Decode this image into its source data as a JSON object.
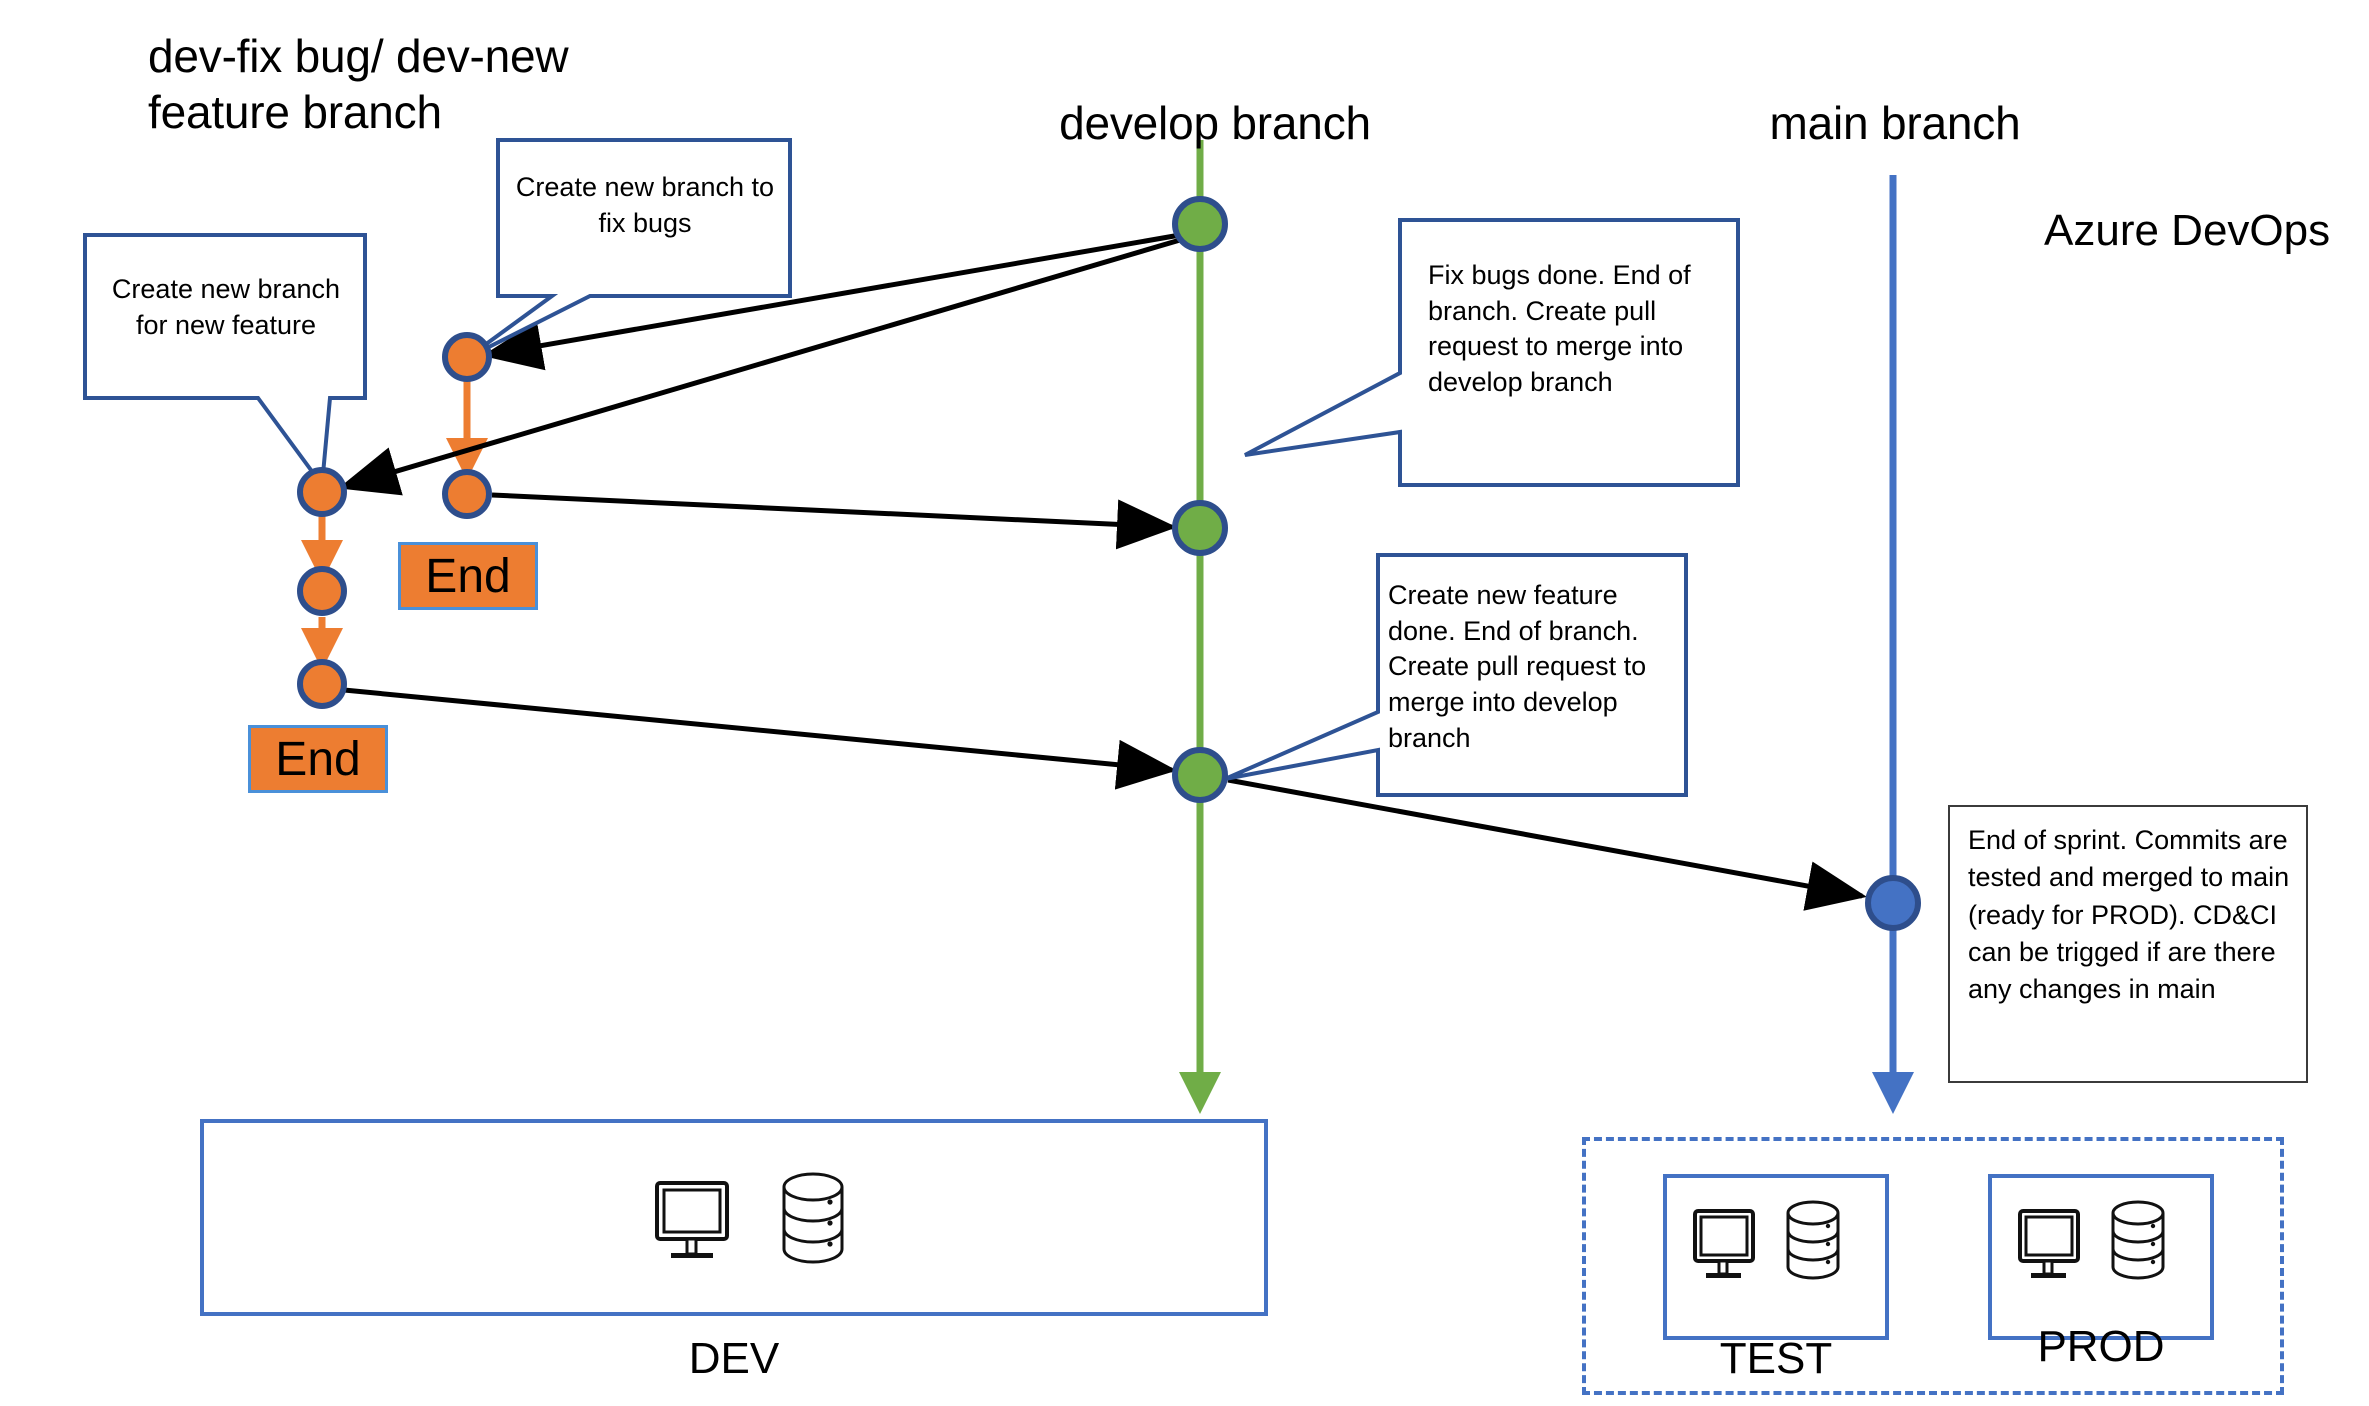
{
  "diagram": {
    "title_note": "Azure DevOps git branching strategy",
    "colors": {
      "orange_fill": "#ED7D31",
      "green_fill": "#70AD47",
      "blue_fill": "#4472C4",
      "node_stroke": "#2E4E8C",
      "callout_stroke": "#2E5395",
      "arrow_black": "#000000",
      "endbox_border": "#4A90D9"
    }
  },
  "branch_labels": [
    {
      "name": "feature-branch-label",
      "text": "dev-fix bug/ dev-new\nfeature branch"
    },
    {
      "name": "develop-branch-label",
      "text": "develop branch"
    },
    {
      "name": "main-branch-label",
      "text": "main branch"
    }
  ],
  "azure_label": "Azure DevOps",
  "callouts": [
    {
      "id": "create-new-branch-for-new-feature",
      "text": "Create new branch\nfor new feature"
    },
    {
      "id": "create-new-branch-to-fix-bugs",
      "text": "Create new branch to\nfix bugs"
    },
    {
      "id": "fix-bugs-done",
      "text": "Fix bugs done. End\nof branch. Create\npull request to\nmerge into develop\nbranch"
    },
    {
      "id": "create-new-feature-done",
      "text": "Create new feature\ndone. End of branch.\nCreate pull request\nto merge into\ndevelop branch"
    }
  ],
  "notes": [
    {
      "id": "end-of-sprint-note",
      "text": "End of sprint. Commits are\ntested and merged to main\n(ready for PROD). CD&CI\ncan be trigged if are there\nany changes in main"
    }
  ],
  "end_markers": [
    {
      "id": "end-marker-fixbug",
      "label": "End"
    },
    {
      "id": "end-marker-feature",
      "label": "End"
    }
  ],
  "environments": [
    {
      "id": "dev-environment",
      "label": "DEV",
      "icons": [
        "monitor-icon",
        "database-icon"
      ]
    },
    {
      "id": "test-environment",
      "label": "TEST",
      "icons": [
        "monitor-icon",
        "database-icon"
      ]
    },
    {
      "id": "prod-environment",
      "label": "PROD",
      "icons": [
        "monitor-icon",
        "database-icon"
      ]
    }
  ],
  "nodes": {
    "develop_commits": 3,
    "feature_commits": 5,
    "main_commits": 1
  }
}
